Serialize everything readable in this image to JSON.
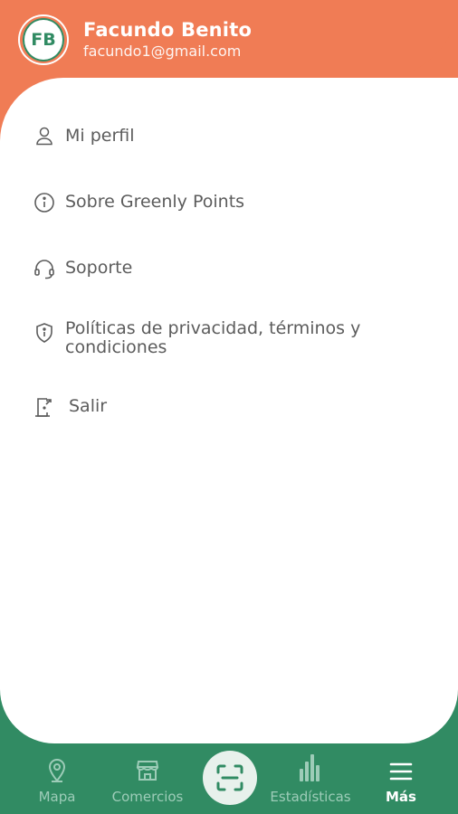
{
  "user": {
    "initials": "FB",
    "name": "Facundo Benito",
    "email": "facundo1@gmail.com"
  },
  "menu": {
    "items": [
      {
        "label": "Mi perfil",
        "icon": "user-icon"
      },
      {
        "label": "Sobre Greenly Points",
        "icon": "info-icon"
      },
      {
        "label": "Soporte",
        "icon": "headset-icon"
      },
      {
        "label": "Políticas de privacidad, términos y condiciones",
        "icon": "shield-icon"
      },
      {
        "label": "Salir",
        "icon": "logout-icon"
      }
    ]
  },
  "nav": {
    "items": [
      {
        "label": "Mapa",
        "icon": "map-pin-icon"
      },
      {
        "label": "Comercios",
        "icon": "store-icon"
      },
      {
        "label": "Estadísticas",
        "icon": "bar-chart-icon"
      },
      {
        "label": "Más",
        "icon": "menu-icon",
        "active": true
      }
    ],
    "scan": {
      "icon": "scan-icon"
    }
  },
  "colors": {
    "header": "#f07c55",
    "primary": "#318b63",
    "card": "#ffffff",
    "text": "#5c5c5c",
    "nav_inactive": "#9dccb8"
  }
}
